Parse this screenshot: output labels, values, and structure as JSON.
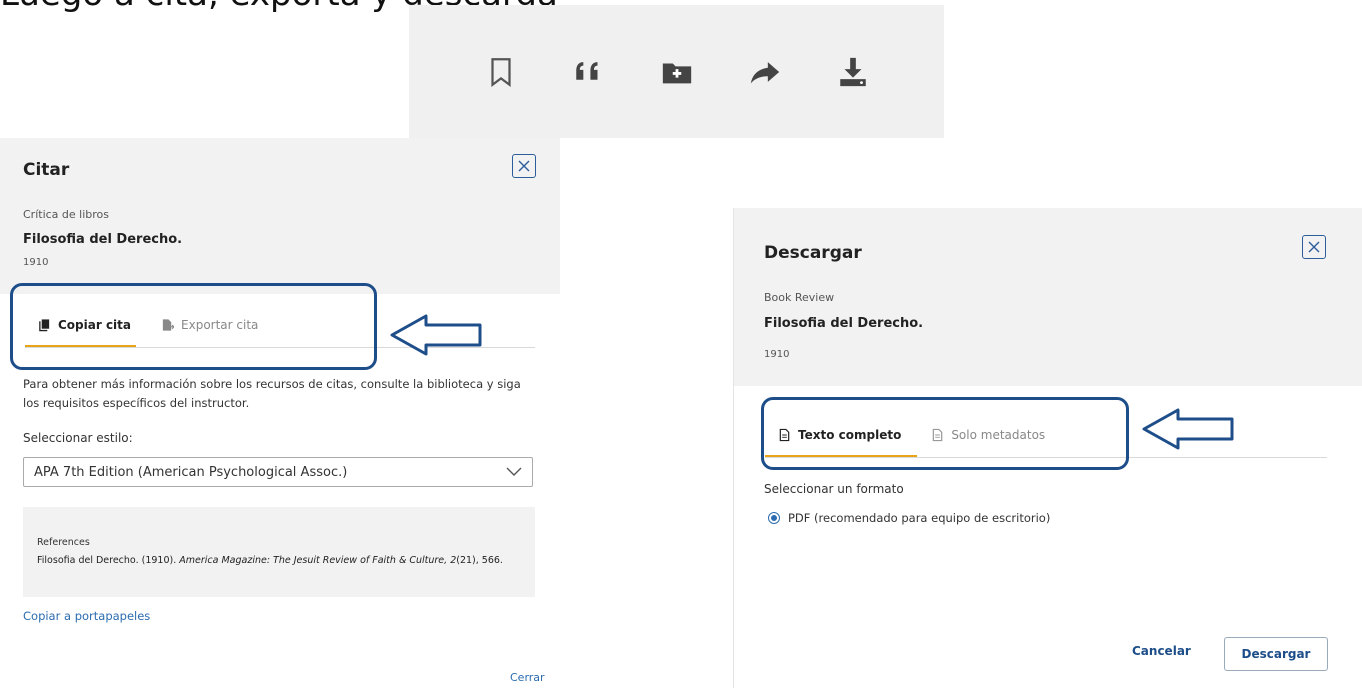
{
  "caption": "Luego a cita, exporta y descarga",
  "toolbar": {
    "icons": [
      "bookmark-icon",
      "quote-icon",
      "folder-add-icon",
      "share-icon",
      "download-icon"
    ]
  },
  "cite_dialog": {
    "title": "Citar",
    "kind": "Crítica de libros",
    "name": "Filosofia del Derecho.",
    "year": "1910",
    "tab_copy": "Copiar cita",
    "tab_export": "Exportar cita",
    "help_text": "Para obtener más información sobre los recursos de citas, consulte la biblioteca y siga los requisitos específicos del instructor.",
    "style_label": "Seleccionar estilo:",
    "style_value": "APA 7th Edition (American Psychological Assoc.)",
    "ref_title": "References",
    "ref_plain_1": "Filosofia del Derecho. (1910). ",
    "ref_italic": "America Magazine: The Jesuit Review of Faith & Culture, 2",
    "ref_plain_2": "(21), 566.",
    "copy_link": "Copiar a portapapeles",
    "close_link": "Cerrar"
  },
  "download_dialog": {
    "title": "Descargar",
    "kind": "Book Review",
    "name": "Filosofia del Derecho.",
    "year": "1910",
    "tab_full": "Texto completo",
    "tab_meta": "Solo metadatos",
    "format_label": "Seleccionar un formato",
    "format_option": "PDF (recomendado para equipo de escritorio)",
    "cancel": "Cancelar",
    "download": "Descargar"
  },
  "colors": {
    "accent_tab": "#e8a317",
    "highlight": "#1d4e89",
    "link": "#2b6cb0"
  }
}
